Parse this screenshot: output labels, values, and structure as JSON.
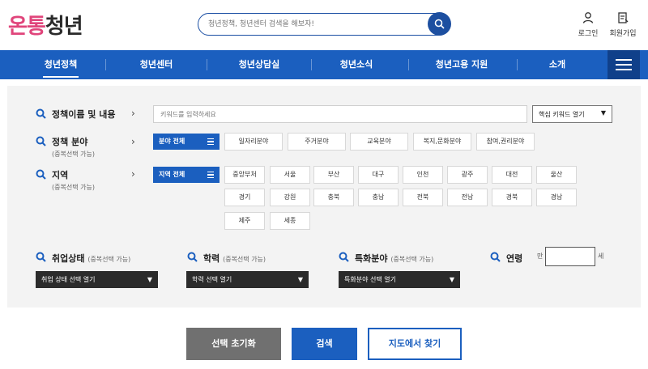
{
  "header": {
    "logo_part1": "온통",
    "logo_part2": "청년",
    "search_placeholder": "청년정책, 청년센터 검색을 해보자!",
    "login_label": "로그인",
    "signup_label": "회원가입"
  },
  "nav": {
    "items": [
      "청년정책",
      "청년센터",
      "청년상담실",
      "청년소식",
      "청년고용 지원",
      "소개"
    ],
    "active": "청년정책"
  },
  "filters": {
    "keyword": {
      "label": "정책이름 및 내용",
      "placeholder": "키워드를 입력하세요",
      "select_label": "핵심 키워드 열기"
    },
    "field": {
      "label": "정책 분야",
      "sub": "(중복선택 가능)",
      "all_label": "분야 전체",
      "chips": [
        "일자리분야",
        "주거분야",
        "교육분야",
        "복지,문화분야",
        "참여,권리분야"
      ]
    },
    "region": {
      "label": "지역",
      "sub": "(중복선택 가능)",
      "all_label": "지역 전체",
      "chips": [
        "중앙부처",
        "서울",
        "부산",
        "대구",
        "인천",
        "광주",
        "대전",
        "울산",
        "경기",
        "강원",
        "충북",
        "충남",
        "전북",
        "전남",
        "경북",
        "경남",
        "제주",
        "세종"
      ]
    },
    "employment": {
      "label": "취업상태",
      "note": "(중복선택 가능)",
      "select_label": "취업 상태 선택 열기"
    },
    "education": {
      "label": "학력",
      "note": "(중복선택 가능)",
      "select_label": "학력 선택 열기"
    },
    "special": {
      "label": "특화분야",
      "note": "(중복선택 가능)",
      "select_label": "특화분야 선택 열기"
    },
    "age": {
      "label": "연령",
      "prefix": "만",
      "suffix": "세",
      "value": ""
    }
  },
  "actions": {
    "reset_label": "선택 초기화",
    "search_label": "검색",
    "map_label": "지도에서 찾기"
  },
  "colors": {
    "primary": "#1b5fbf",
    "dark_dropdown": "#2b2b2b",
    "panel_bg": "#f3f3f3",
    "reset_bg": "#707070"
  }
}
